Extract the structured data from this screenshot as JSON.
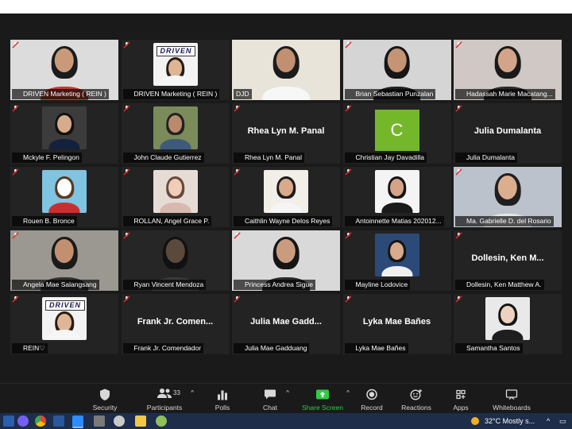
{
  "toolbar": {
    "security": "Security",
    "participants": "Participants",
    "participants_count": "33",
    "polls": "Polls",
    "chat": "Chat",
    "share_screen": "Share Screen",
    "record": "Record",
    "reactions": "Reactions",
    "apps": "Apps",
    "whiteboards": "Whiteboards"
  },
  "tiles": [
    {
      "name": "DRIVEN Marketing ( REIN )"
    },
    {
      "name": "DRIVEN Marketing ( REIN )",
      "logo": "DRIVEN"
    },
    {
      "name": "DJD"
    },
    {
      "name": "Brian Sebastian Punzalan"
    },
    {
      "name": "Hadassah Marie Macatang..."
    },
    {
      "name": "Mckyle F. Pelingon"
    },
    {
      "name": "John Claude Gutierrez"
    },
    {
      "name": "Rhea Lyn M. Panal",
      "big": "Rhea Lyn M. Panal"
    },
    {
      "name": "Christian Jay Davadilla",
      "letter": "C"
    },
    {
      "name": "Julia Dumalanta",
      "big": "Julia Dumalanta"
    },
    {
      "name": "Rouen B. Bronce"
    },
    {
      "name": "ROLLAN, Angel Grace P."
    },
    {
      "name": "Caithlin Wayne Delos Reyes"
    },
    {
      "name": "Antoinnette Matias 202012..."
    },
    {
      "name": "Ma. Gabrielle D. del Rosario"
    },
    {
      "name": "Angela Mae Salangsang"
    },
    {
      "name": "Ryan Vincent Mendoza"
    },
    {
      "name": "Princess Andrea Sigue"
    },
    {
      "name": "Mayline Lodovice"
    },
    {
      "name": "Dollesin, Ken Matthew A.",
      "big": "Dollesin,  Ken  M..."
    },
    {
      "name": "REIN♡",
      "logo": "DRIVEN"
    },
    {
      "name": "Frank Jr. Comendador",
      "big": "Frank  Jr.  Comen..."
    },
    {
      "name": "Julia Mae Gadduang",
      "big": "Julia  Mae  Gadd..."
    },
    {
      "name": "Lyka Mae Bañes",
      "big": "Lyka Mae Bañes"
    },
    {
      "name": "Samantha Santos"
    }
  ],
  "taskbar": {
    "weather": "32°C  Mostly s..."
  },
  "colors": {
    "active_speaker_border": "#c6e46b",
    "share_screen_green": "#2ecc40",
    "mute_red": "#e02828",
    "letter_avatar_bg": "#75b72b"
  }
}
